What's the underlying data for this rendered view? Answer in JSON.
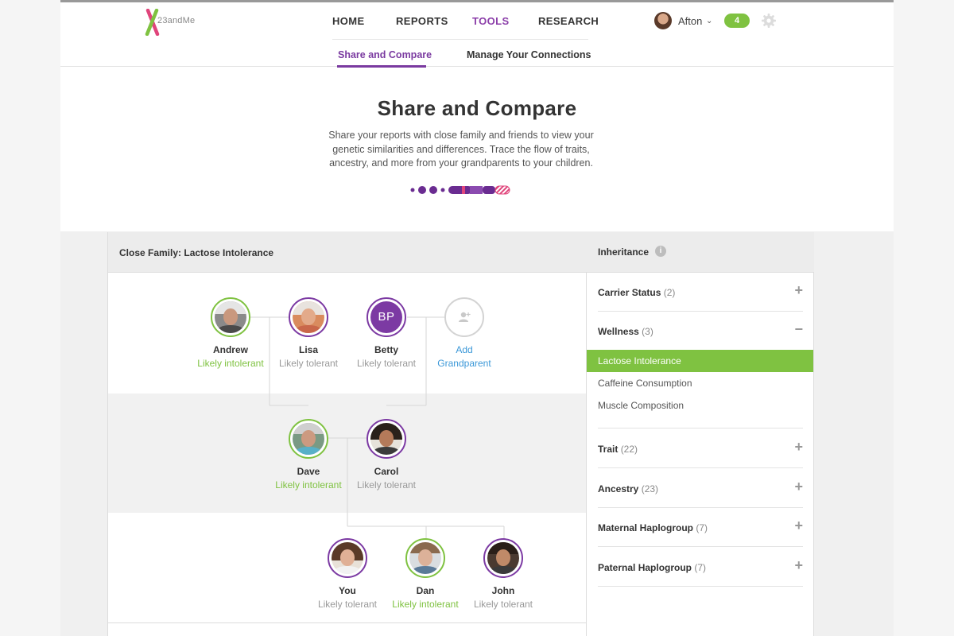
{
  "brand": {
    "logo_text": "23andMe",
    "accent": "#7c3aa3",
    "green": "#7fc241"
  },
  "nav": {
    "items": [
      {
        "label": "HOME",
        "active": false
      },
      {
        "label": "REPORTS",
        "active": false
      },
      {
        "label": "TOOLS",
        "active": true
      },
      {
        "label": "RESEARCH",
        "active": false
      }
    ],
    "subnav": [
      {
        "label": "Share and Compare",
        "active": true
      },
      {
        "label": "Manage Your Connections",
        "active": false
      }
    ]
  },
  "user": {
    "name": "Afton",
    "caret": "⌄",
    "notifications": "4"
  },
  "hero": {
    "title": "Share and Compare",
    "description": "Share your reports with close family and friends to view your genetic similarities and differences. Trace the flow of traits, ancestry, and more from your grandparents to your children."
  },
  "panel": {
    "title": "Close Family: Lactose Intolerance",
    "grandparents": [
      {
        "name": "Andrew",
        "status": "Likely intolerant",
        "ring": "green",
        "icon": "avatar-andrew"
      },
      {
        "name": "Lisa",
        "status": "Likely tolerant",
        "ring": "purple",
        "icon": "avatar-lisa"
      },
      {
        "name": "Betty",
        "status": "Likely tolerant",
        "ring": "purple",
        "initials": "BP"
      },
      {
        "name": "Add",
        "status": "Grandparent",
        "ring": "grey",
        "icon": "add-person-icon"
      }
    ],
    "parents": [
      {
        "name": "Dave",
        "status": "Likely intolerant",
        "ring": "green"
      },
      {
        "name": "Carol",
        "status": "Likely tolerant",
        "ring": "purple"
      }
    ],
    "children": [
      {
        "name": "You",
        "status": "Likely tolerant",
        "ring": "purple"
      },
      {
        "name": "Dan",
        "status": "Likely intolerant",
        "ring": "green"
      },
      {
        "name": "John",
        "status": "Likely tolerant",
        "ring": "purple"
      }
    ]
  },
  "sidebar": {
    "title": "Inheritance",
    "info_icon": "i",
    "categories": [
      {
        "label": "Carrier Status",
        "count": "(2)",
        "toggle": "+"
      },
      {
        "label": "Wellness",
        "count": "(3)",
        "toggle": "−"
      },
      {
        "label": "Trait",
        "count": "(22)",
        "toggle": "+"
      },
      {
        "label": "Ancestry",
        "count": "(23)",
        "toggle": "+"
      },
      {
        "label": "Maternal Haplogroup",
        "count": "(7)",
        "toggle": "+"
      },
      {
        "label": "Paternal Haplogroup",
        "count": "(7)",
        "toggle": "+"
      }
    ],
    "wellness_items": [
      {
        "label": "Lactose Intolerance",
        "selected": true
      },
      {
        "label": "Caffeine Consumption",
        "selected": false
      },
      {
        "label": "Muscle Composition",
        "selected": false
      }
    ]
  }
}
